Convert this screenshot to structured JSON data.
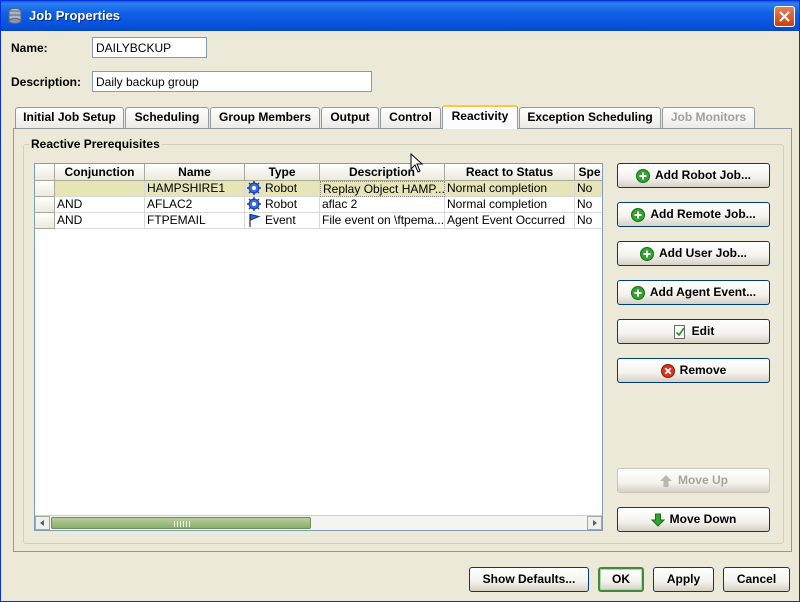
{
  "window": {
    "title": "Job Properties"
  },
  "form": {
    "name_label": "Name:",
    "name_value": "DAILYBCKUP",
    "description_label": "Description:",
    "description_value": "Daily backup group"
  },
  "tabs": [
    {
      "label": "Initial Job Setup"
    },
    {
      "label": "Scheduling"
    },
    {
      "label": "Group Members"
    },
    {
      "label": "Output"
    },
    {
      "label": "Control"
    },
    {
      "label": "Reactivity",
      "active": true
    },
    {
      "label": "Exception Scheduling"
    },
    {
      "label": "Job Monitors",
      "disabled": true
    }
  ],
  "group": {
    "title": "Reactive Prerequisites"
  },
  "table": {
    "columns": [
      "Conjunction",
      "Name",
      "Type",
      "Description",
      "React to Status",
      "Spe"
    ],
    "rows": [
      {
        "conjunction": "",
        "name": "HAMPSHIRE1",
        "type": "Robot",
        "type_icon": "gear-icon",
        "description": "Replay Object HAMP...",
        "status": "Normal completion",
        "spe": "No",
        "selected": true
      },
      {
        "conjunction": "AND",
        "name": "AFLAC2",
        "type": "Robot",
        "type_icon": "gear-icon",
        "description": "aflac 2",
        "status": "Normal completion",
        "spe": "No"
      },
      {
        "conjunction": "AND",
        "name": "FTPEMAIL",
        "type": "Event",
        "type_icon": "flag-icon",
        "description": "File event on \\ftpema...",
        "status": "Agent Event Occurred",
        "spe": "No"
      }
    ]
  },
  "side_buttons": {
    "add_robot": "Add Robot Job...",
    "add_remote": "Add Remote Job...",
    "add_user": "Add User Job...",
    "add_agent": "Add Agent Event...",
    "edit": "Edit",
    "remove": "Remove",
    "move_up": "Move Up",
    "move_down": "Move Down"
  },
  "footer_buttons": {
    "show_defaults": "Show Defaults...",
    "ok": "OK",
    "apply": "Apply",
    "cancel": "Cancel"
  },
  "colors": {
    "titlebar": "#0550d8",
    "selected_row": "#e6e5b7",
    "active_tab_accent": "#ffc83c",
    "add_icon": "#2fa52f",
    "remove_icon": "#d8341c"
  }
}
